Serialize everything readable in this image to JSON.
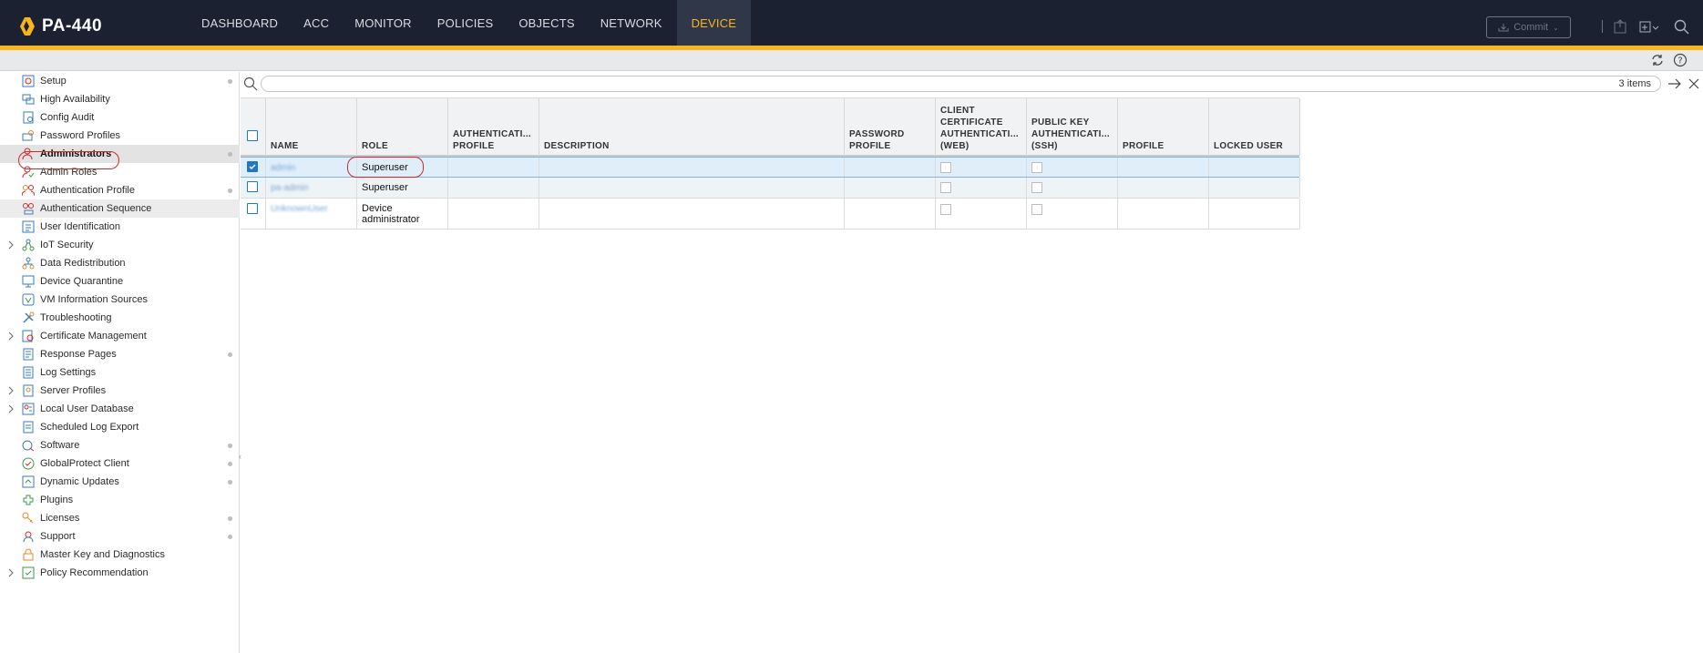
{
  "header": {
    "device_name": "PA-440",
    "tabs": [
      {
        "label": "DASHBOARD"
      },
      {
        "label": "ACC"
      },
      {
        "label": "MONITOR"
      },
      {
        "label": "POLICIES"
      },
      {
        "label": "OBJECTS"
      },
      {
        "label": "NETWORK"
      },
      {
        "label": "DEVICE"
      }
    ],
    "active_tab": "DEVICE",
    "commit_label": "Commit",
    "accent_color": "#f9b51b",
    "bg_color": "#1b2130"
  },
  "sidebar": {
    "selected": "Administrators",
    "items": [
      {
        "label": "Setup",
        "icon": "setup-icon",
        "dot": true
      },
      {
        "label": "High Availability",
        "icon": "high-availability-icon"
      },
      {
        "label": "Config Audit",
        "icon": "config-audit-icon"
      },
      {
        "label": "Password Profiles",
        "icon": "password-profiles-icon"
      },
      {
        "label": "Administrators",
        "icon": "administrators-icon",
        "dot": true
      },
      {
        "label": "Admin Roles",
        "icon": "admin-roles-icon"
      },
      {
        "label": "Authentication Profile",
        "icon": "authentication-profile-icon",
        "dot": true
      },
      {
        "label": "Authentication Sequence",
        "icon": "authentication-sequence-icon"
      },
      {
        "label": "User Identification",
        "icon": "user-identification-icon"
      },
      {
        "label": "IoT Security",
        "icon": "iot-security-icon",
        "expandable": true
      },
      {
        "label": "Data Redistribution",
        "icon": "data-redistribution-icon"
      },
      {
        "label": "Device Quarantine",
        "icon": "device-quarantine-icon"
      },
      {
        "label": "VM Information Sources",
        "icon": "vm-information-sources-icon"
      },
      {
        "label": "Troubleshooting",
        "icon": "troubleshooting-icon"
      },
      {
        "label": "Certificate Management",
        "icon": "certificate-management-icon",
        "expandable": true
      },
      {
        "label": "Response Pages",
        "icon": "response-pages-icon",
        "dot": true
      },
      {
        "label": "Log Settings",
        "icon": "log-settings-icon"
      },
      {
        "label": "Server Profiles",
        "icon": "server-profiles-icon",
        "expandable": true
      },
      {
        "label": "Local User Database",
        "icon": "local-user-database-icon",
        "expandable": true
      },
      {
        "label": "Scheduled Log Export",
        "icon": "scheduled-log-export-icon"
      },
      {
        "label": "Software",
        "icon": "software-icon",
        "dot": true
      },
      {
        "label": "GlobalProtect Client",
        "icon": "globalprotect-client-icon",
        "dot": true
      },
      {
        "label": "Dynamic Updates",
        "icon": "dynamic-updates-icon",
        "dot": true
      },
      {
        "label": "Plugins",
        "icon": "plugins-icon"
      },
      {
        "label": "Licenses",
        "icon": "licenses-icon",
        "dot": true
      },
      {
        "label": "Support",
        "icon": "support-icon",
        "dot": true
      },
      {
        "label": "Master Key and Diagnostics",
        "icon": "master-key-icon"
      },
      {
        "label": "Policy Recommendation",
        "icon": "policy-recommendation-icon",
        "expandable": true
      }
    ]
  },
  "search": {
    "placeholder": "",
    "count": "3 items"
  },
  "grid": {
    "columns": [
      {
        "label": ""
      },
      {
        "label": "NAME"
      },
      {
        "label": "ROLE"
      },
      {
        "label": "AUTHENTICATI... PROFILE"
      },
      {
        "label": "DESCRIPTION"
      },
      {
        "label": "PASSWORD PROFILE"
      },
      {
        "label": "CLIENT CERTIFICATE AUTHENTICATI... (WEB)"
      },
      {
        "label": "PUBLIC KEY AUTHENTICATI... (SSH)"
      },
      {
        "label": "PROFILE"
      },
      {
        "label": "LOCKED USER"
      }
    ],
    "rows": [
      {
        "name": "admin",
        "role": "Superuser",
        "checked": true
      },
      {
        "name": "pa-admin",
        "role": "Superuser",
        "checked": false
      },
      {
        "name": "UnknownUser",
        "role": "Device administrator",
        "checked": false
      }
    ]
  }
}
